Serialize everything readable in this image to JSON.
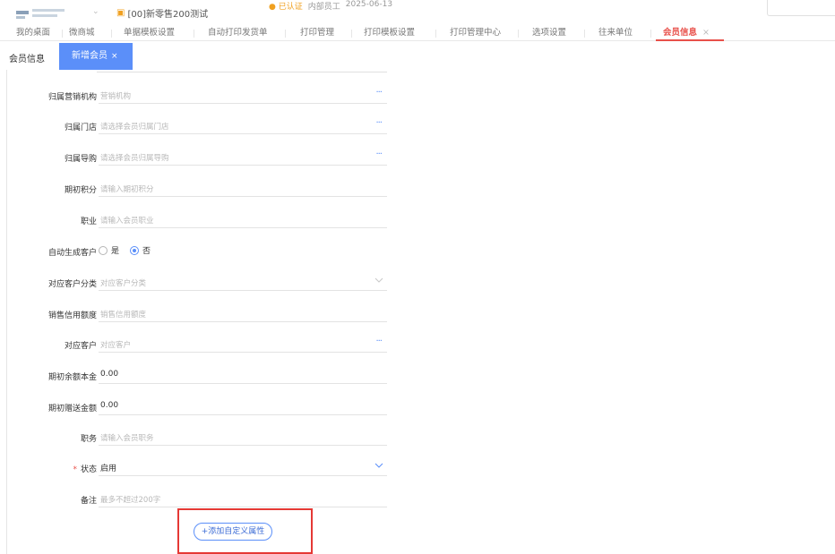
{
  "header": {
    "company": "[00]新零售200测试",
    "auth_status": "已认证",
    "edition": "内部员工",
    "date": "2025-06-13"
  },
  "tabs": [
    {
      "label": "我的桌面",
      "active": false
    },
    {
      "label": "微商城",
      "active": false
    },
    {
      "label": "单据模板设置",
      "active": false
    },
    {
      "label": "自动打印发货单",
      "active": false
    },
    {
      "label": "打印管理",
      "active": false
    },
    {
      "label": "打印模板设置",
      "active": false
    },
    {
      "label": "打印管理中心",
      "active": false
    },
    {
      "label": "选项设置",
      "active": false
    },
    {
      "label": "往来单位",
      "active": false
    },
    {
      "label": "会员信息",
      "active": true
    }
  ],
  "tab_close": "×",
  "subtabs": {
    "first": "会员信息",
    "second": "新增会员",
    "close": "×"
  },
  "form": {
    "marketing_org": {
      "label": "归属营销机构",
      "placeholder": "营销机构"
    },
    "store": {
      "label": "归属门店",
      "placeholder": "请选择会员归属门店"
    },
    "guide": {
      "label": "归属导购",
      "placeholder": "请选择会员归属导购"
    },
    "initial_points": {
      "label": "期初积分",
      "placeholder": "请输入期初积分"
    },
    "occupation": {
      "label": "职业",
      "placeholder": "请输入会员职业"
    },
    "auto_customer": {
      "label": "自动生成客户",
      "option_yes": "是",
      "option_no": "否",
      "selected": "否"
    },
    "customer_category": {
      "label": "对应客户分类",
      "placeholder": "对应客户分类"
    },
    "credit_limit": {
      "label": "销售信用额度",
      "placeholder": "销售信用额度"
    },
    "customer": {
      "label": "对应客户",
      "placeholder": "对应客户"
    },
    "initial_balance": {
      "label": "期初余额本金",
      "value": "0.00"
    },
    "initial_gift": {
      "label": "期初赠送金额",
      "value": "0.00"
    },
    "position": {
      "label": "职务",
      "placeholder": "请输入会员职务"
    },
    "status": {
      "label": "状态",
      "required_mark": "*",
      "value": "启用"
    },
    "remark": {
      "label": "备注",
      "placeholder": "最多不超过200字"
    }
  },
  "add_custom_button": "+添加自定义属性",
  "colors": {
    "accent": "#5b8ff9",
    "active_tab": "#e8504a",
    "highlight_box": "#e53935"
  }
}
